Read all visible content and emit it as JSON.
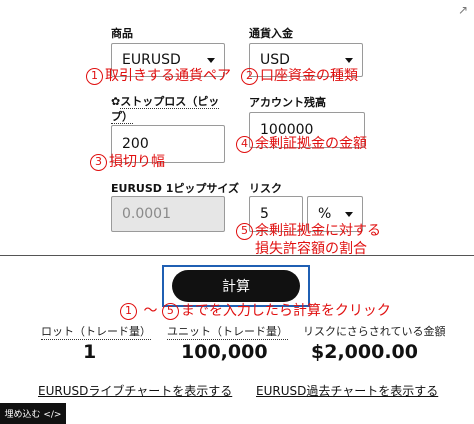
{
  "corner_icon": "external-link-icon",
  "fields": {
    "product": {
      "label": "商品",
      "value": "EURUSD"
    },
    "account_currency": {
      "label": "通貨入金",
      "value": "USD"
    },
    "stop_loss": {
      "label_prefix": "✿",
      "label_line1": "ストップロス（ピッ",
      "label_line2": "プ）",
      "value": "200"
    },
    "account_balance": {
      "label": "アカウント残高",
      "value": "100000"
    },
    "pip_size": {
      "label": "EURUSD 1ピップサイズ",
      "value": "0.0001"
    },
    "risk": {
      "label": "リスク",
      "value": "5",
      "unit": "%"
    }
  },
  "annotations": {
    "a1": {
      "num": "1",
      "text": "取引きする通貨ペア"
    },
    "a2": {
      "num": "2",
      "text": "口座資金の種類"
    },
    "a3": {
      "num": "3",
      "text": "損切り幅"
    },
    "a4": {
      "num": "4",
      "text": "余剰証拠金の金額"
    },
    "a5": {
      "num": "5",
      "line1": "余剰証拠金に対する",
      "line2": "損失許容額の割合"
    },
    "a6": {
      "num_start": "1",
      "mid": " ～ ",
      "num_end": "5",
      "text": "までを入力したら計算をクリック"
    }
  },
  "calculate_button": "計算",
  "results": {
    "lot": {
      "label": "ロット（トレード量）",
      "value": "1"
    },
    "units": {
      "label": "ユニット（トレード量）",
      "value": "100,000"
    },
    "risk_amount": {
      "label": "リスクにさらされている金額",
      "value": "$2,000.00"
    }
  },
  "links": {
    "live_chart": "EURUSDライブチャートを表示する",
    "past_chart": "EURUSD過去チャートを表示する"
  },
  "embed_button": "埋め込む </>",
  "colors": {
    "annotation": "#e01010",
    "frame": "#1f5fb3",
    "button": "#111111"
  }
}
